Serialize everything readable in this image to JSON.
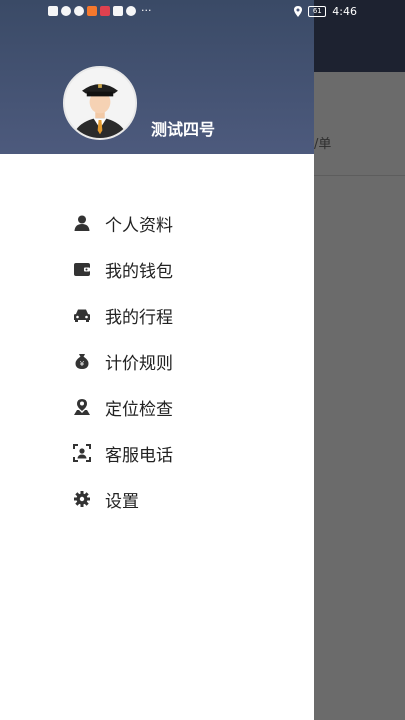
{
  "background": {
    "order_unit_text": "/单"
  },
  "statusbar": {
    "battery": "61",
    "time": "4:46"
  },
  "profile": {
    "username": "测试四号"
  },
  "menu": {
    "items": [
      {
        "label": "个人资料",
        "icon": "person-icon"
      },
      {
        "label": "我的钱包",
        "icon": "wallet-icon"
      },
      {
        "label": "我的行程",
        "icon": "car-icon"
      },
      {
        "label": "计价规则",
        "icon": "money-bag-icon"
      },
      {
        "label": "定位检查",
        "icon": "location-person-icon"
      },
      {
        "label": "客服电话",
        "icon": "customer-service-icon"
      },
      {
        "label": "设置",
        "icon": "gear-icon"
      }
    ]
  },
  "colors": {
    "header": "#4d5a7d",
    "overlay": "#6b6b6b",
    "text": "#222222"
  }
}
